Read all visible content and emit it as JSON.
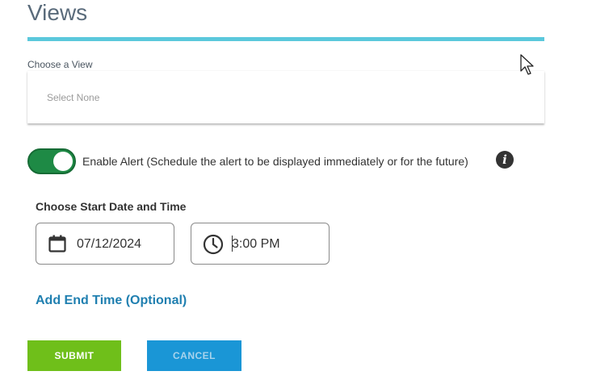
{
  "header": {
    "title": "Views"
  },
  "view_select": {
    "label": "Choose a View",
    "value": "Select None"
  },
  "alert_toggle": {
    "enabled": true,
    "label": "Enable Alert (Schedule the alert to be displayed immediately or for the future)"
  },
  "info": {
    "icon": "info-icon",
    "glyph": "i"
  },
  "start": {
    "heading": "Choose Start Date and Time",
    "date_value": "07/12/2024",
    "time_value": "3:00 PM",
    "date_icon": "calendar-icon",
    "time_icon": "clock-icon"
  },
  "end_time_link": "Add End Time (Optional)",
  "buttons": {
    "submit": "SUBMIT",
    "cancel": "CANCEL"
  },
  "colors": {
    "accent_rule": "#5bc8dc",
    "toggle_on": "#1e8a45",
    "link": "#1f7fb0",
    "submit_bg": "#6fbf1a",
    "cancel_bg": "#1a96d6"
  }
}
